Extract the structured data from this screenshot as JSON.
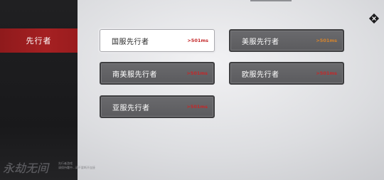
{
  "sidebar": {
    "active_tab": "先行者"
  },
  "servers": [
    {
      "name": "国服先行者",
      "ping": ">501ms",
      "selected": true,
      "ping_color": "#c4282a"
    },
    {
      "name": "美服先行者",
      "ping": ">501ms",
      "selected": false,
      "ping_color": "#d6842c"
    },
    {
      "name": "南美服先行者",
      "ping": ">501ms",
      "selected": false,
      "ping_color": "#c4282a"
    },
    {
      "name": "欧服先行者",
      "ping": ">501ms",
      "selected": false,
      "ping_color": "#c4282a"
    },
    {
      "name": "亚服先行者",
      "ping": ">501ms",
      "selected": false,
      "ping_color": "#c4282a"
    }
  ],
  "footer": {
    "logo_text": "永劫无间",
    "line1": "先行者游戏",
    "line2": "请保持署中...请不要断开连接"
  },
  "colors": {
    "accent_red": "#a52022",
    "sidebar_bg": "#1c1c1e"
  }
}
